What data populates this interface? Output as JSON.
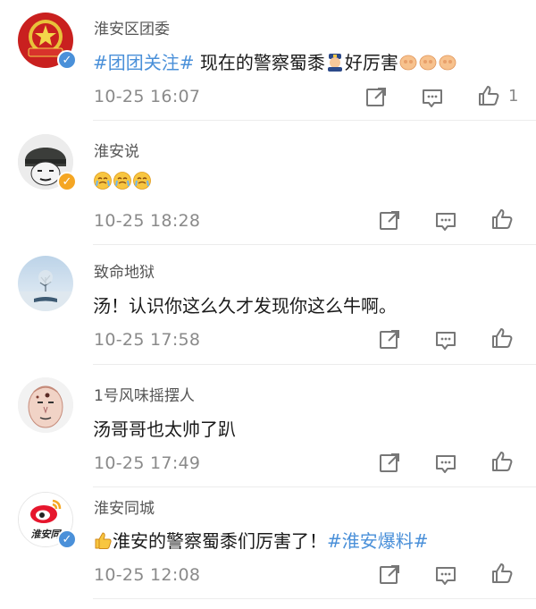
{
  "comments": [
    {
      "name": "淮安区团委",
      "hashtag": "#团团关注#",
      "text_before": " 现在的警察蜀黍",
      "text_after": "好厉害",
      "time": "10-25 16:07",
      "likes": "1",
      "verified_color": "#4a90d9"
    },
    {
      "name": "淮安说",
      "time": "10-25 18:28",
      "verified_color": "#f5a623"
    },
    {
      "name": "致命地狱",
      "text": "汤！认识你这么久才发现你这么牛啊。",
      "time": "10-25 17:58"
    },
    {
      "name": "1号风味摇摆人",
      "text": "汤哥哥也太帅了趴",
      "time": "10-25 17:49"
    },
    {
      "name": "淮安同城",
      "text": "淮安的警察蜀黍们厉害了！",
      "hashtag": "#淮安爆料#",
      "time": "10-25 12:08",
      "avatar_label": "淮安同",
      "verified_color": "#4a90d9"
    }
  ],
  "icons": {
    "repost": "repost-icon",
    "comment": "comment-icon",
    "like": "thumbs-up-icon",
    "verified": "checkmark"
  }
}
